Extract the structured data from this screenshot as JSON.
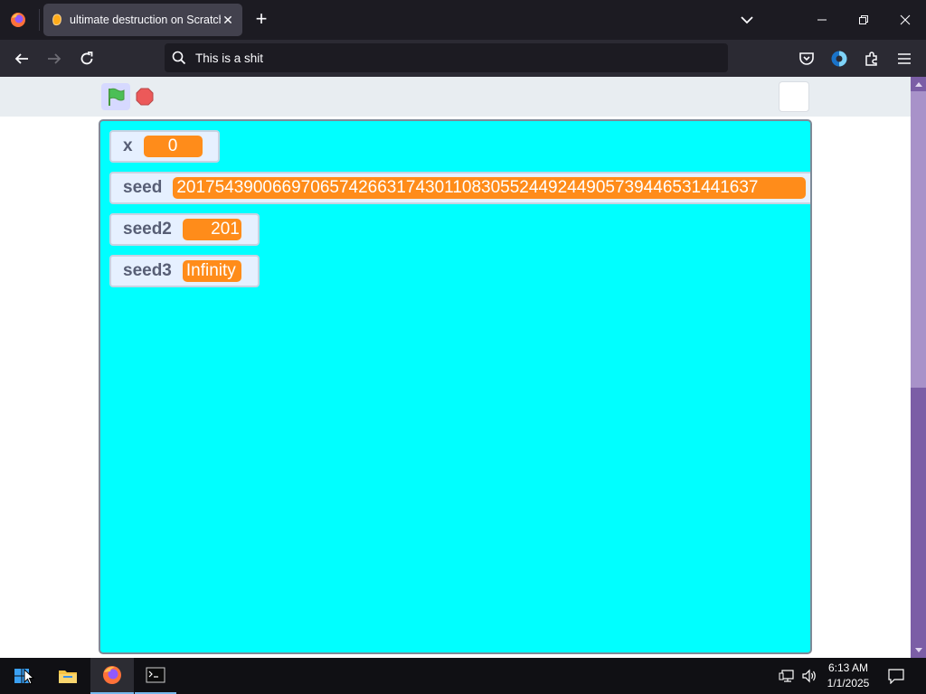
{
  "browser": {
    "tab": {
      "title": "ultimate destruction on Scratch"
    },
    "url": "This is a shit"
  },
  "stage": {
    "monitors": [
      {
        "label": "x",
        "value": "0"
      },
      {
        "label": "seed",
        "value": "2017543900669706574266317430110830552449244905739446531441637"
      },
      {
        "label": "seed2",
        "value": "201"
      },
      {
        "label": "seed3",
        "value": "Infinity"
      }
    ],
    "colors": {
      "stage_bg": "#00ffff",
      "monitor_value": "#ff8c1a"
    }
  },
  "taskbar": {
    "time": "6:13 AM",
    "date": "1/1/2025"
  }
}
